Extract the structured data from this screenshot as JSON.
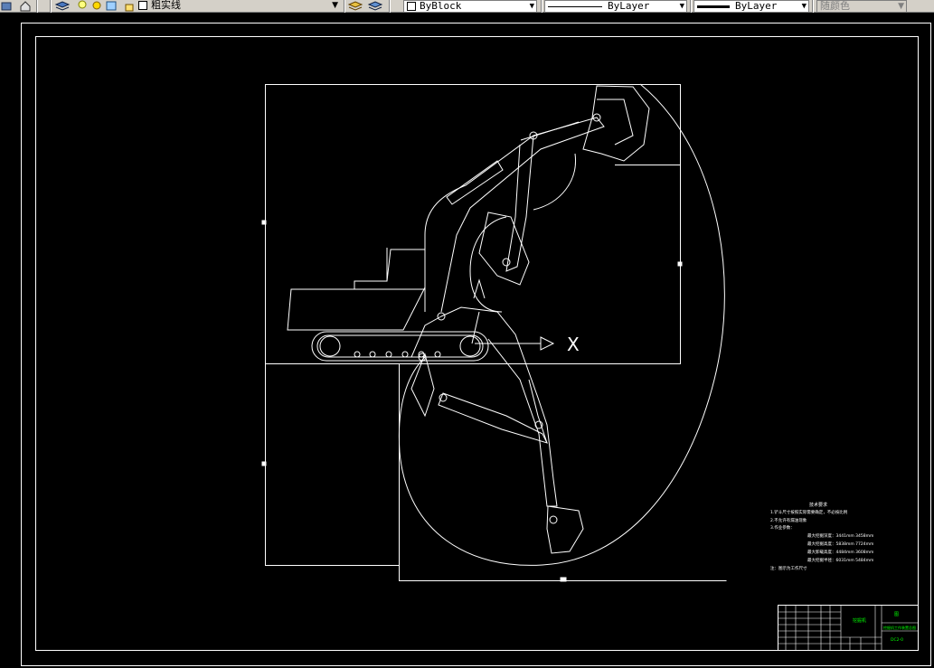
{
  "toolbar": {
    "layer_name": "粗实线",
    "color_value": "ByBlock",
    "linetype_value": "ByLayer",
    "lineweight_value": "ByLayer",
    "plotstyle_value": "随颜色"
  },
  "drawing": {
    "axis_label": "X",
    "tech_requirements": {
      "title": "技术要求",
      "items": [
        "1.铲斗尺寸按照实际需要确定，不必按比例",
        "2.不允许有漏油现象",
        "3.作业参数："
      ],
      "params": [
        "最大挖掘深度：3441mm 3458mm",
        "最大挖掘高度：5838mm 7724mm",
        "最大卸载高度：4484mm 3608mm",
        "最大挖掘半径：6031mm 5484mm"
      ],
      "note": "注：图示为工作尺寸"
    },
    "title_block": {
      "company_label": "挖掘机",
      "drawing_name": "挖掘机工作装置总图",
      "drawing_number": "DC2-0",
      "sheet_label": "图"
    }
  }
}
